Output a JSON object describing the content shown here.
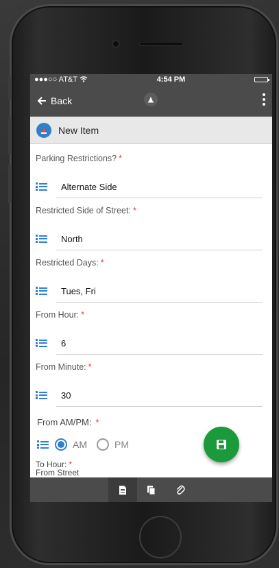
{
  "statusbar": {
    "carrier": "●●●○○ AT&T",
    "time": "4:54 PM"
  },
  "navbar": {
    "back_label": "Back"
  },
  "titlebar": {
    "title": "New Item"
  },
  "fields": [
    {
      "label": "Parking Restrictions?",
      "value": "Alternate Side"
    },
    {
      "label": "Restricted Side of Street:",
      "value": "North"
    },
    {
      "label": "Restricted Days:",
      "value": "Tues, Fri"
    },
    {
      "label": "From Hour:",
      "value": "6"
    },
    {
      "label": "From Minute:",
      "value": "30"
    }
  ],
  "ampm": {
    "label": "From AM/PM:",
    "options": [
      "AM",
      "PM"
    ],
    "selected": "AM"
  },
  "partial": {
    "to_hour": "To Hour:",
    "from_street": "From Street"
  },
  "colors": {
    "accent": "#2f7fd0",
    "required": "#e53935",
    "fab": "#1a9a3a",
    "bar": "#4b4b4b"
  },
  "icons": {
    "back": "arrow-left-icon",
    "menu": "kebab-icon",
    "list": "list-icon",
    "save": "floppy-save-icon",
    "tabs": [
      "document-icon",
      "copy-icon",
      "paperclip-icon"
    ]
  }
}
